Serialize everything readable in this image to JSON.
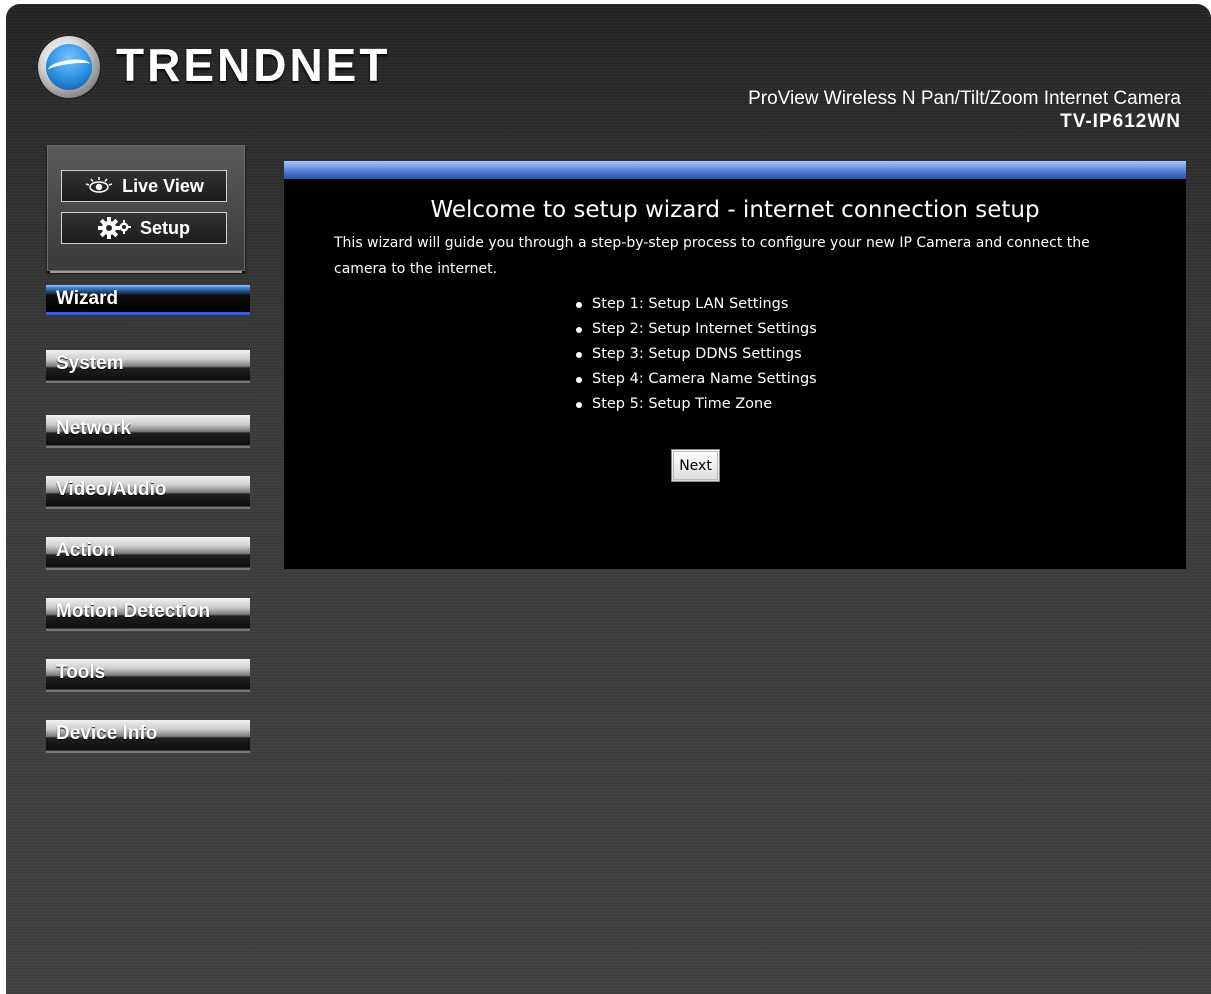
{
  "header": {
    "brand": "TRENDNET",
    "product_name": "ProView Wireless N Pan/Tilt/Zoom Internet Camera",
    "model": "TV-IP612WN"
  },
  "mode_buttons": {
    "live_view": "Live View",
    "setup": "Setup"
  },
  "sidebar": {
    "items": [
      {
        "label": "Wizard",
        "active": true
      },
      {
        "label": "System"
      },
      {
        "label": "Network"
      },
      {
        "label": "Video/Audio"
      },
      {
        "label": "Action"
      },
      {
        "label": "Motion Detection"
      },
      {
        "label": "Tools"
      },
      {
        "label": "Device Info"
      }
    ]
  },
  "main": {
    "title": "Welcome to setup wizard - internet connection setup",
    "description": "This wizard will guide you through a step-by-step process to configure your new IP Camera and connect the camera to the internet.",
    "steps": [
      "Step 1: Setup LAN Settings",
      "Step 2: Setup Internet Settings",
      "Step 3: Setup DDNS Settings",
      "Step 4: Camera Name Settings",
      "Step 5: Setup Time Zone"
    ],
    "next_label": "Next"
  },
  "colors": {
    "panel_bar": "#5e86d9",
    "active_underline": "#2f5fe0",
    "background": "#3a3a3a"
  }
}
